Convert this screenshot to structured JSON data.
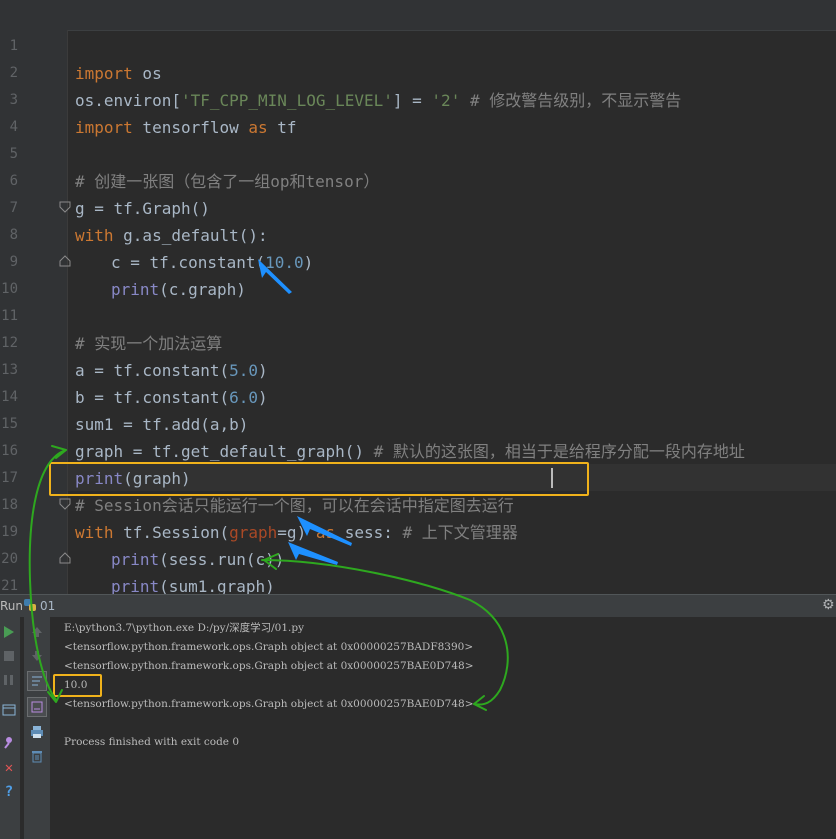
{
  "editor": {
    "line_numbers": [
      "1",
      "2",
      "3",
      "4",
      "5",
      "6",
      "7",
      "8",
      "9",
      "10",
      "11",
      "12",
      "13",
      "14",
      "15",
      "16",
      "17",
      "18",
      "19",
      "20",
      "21"
    ],
    "lines": {
      "l1": {
        "kw": "import",
        "rest": " os"
      },
      "l2": {
        "a": "os.environ[",
        "str1": "'TF_CPP_MIN_LOG_LEVEL'",
        "b": "] = ",
        "str2": "'2'",
        "cmt": " # 修改警告级别，不显示警告"
      },
      "l3": {
        "kw1": "import",
        "mid": " tensorflow ",
        "kw2": "as",
        "rest": " tf"
      },
      "l5": {
        "cmt": "# 创建一张图（包含了一组op和tensor）"
      },
      "l6": {
        "text": "g = tf.Graph()"
      },
      "l7": {
        "kw": "with",
        "rest": " g.as_default():"
      },
      "l8": {
        "a": "c = tf.constant(",
        "num": "10.0",
        "b": ")"
      },
      "l9": {
        "bi": "print",
        "rest": "(c.graph)"
      },
      "l11": {
        "cmt": "# 实现一个加法运算"
      },
      "l12": {
        "a": "a = tf.constant(",
        "num": "5.0",
        "b": ")"
      },
      "l13": {
        "a": "b = tf.constant(",
        "num": "6.0",
        "b": ")"
      },
      "l14": {
        "text": "sum1 = tf.add(a,b)"
      },
      "l15": {
        "text": "graph = tf.get_default_graph()",
        "cmt": " # 默认的这张图，相当于是给程序分配一段内存地址"
      },
      "l16": {
        "bi": "print",
        "rest": "(graph)"
      },
      "l17": {
        "cmt": "# Session会话只能运行一个图，可以在会话中指定图去运行"
      },
      "l18": {
        "kw": "with",
        "a": " tf.Session(",
        "prm": "graph",
        "b": "=g) ",
        "kw2": "as",
        "c": " sess:",
        "cmt": " # 上下文管理器"
      },
      "l19": {
        "bi": "print",
        "rest": "(sess.run(c))"
      },
      "l20": {
        "bi": "print",
        "rest": "(sum1.graph)"
      }
    }
  },
  "run": {
    "title": "Run",
    "config_name": "01"
  },
  "console": {
    "lines": [
      "E:\\python3.7\\python.exe D:/py/深度学习/01.py",
      "<tensorflow.python.framework.ops.Graph object at 0x00000257BADF8390>",
      "<tensorflow.python.framework.ops.Graph object at 0x00000257BAE0D748>",
      "10.0",
      "<tensorflow.python.framework.ops.Graph object at 0x00000257BAE0D748>",
      "",
      "Process finished with exit code 0"
    ]
  },
  "colors": {
    "background": "#2b2b2b",
    "keyword": "#cc7832",
    "string": "#6a8759",
    "number": "#6897bb",
    "comment": "#808080",
    "builtin": "#8888c6",
    "highlight_box": "#f0b21b",
    "annotation_blue": "#1e90ff",
    "annotation_green": "#2ea81f"
  },
  "icons": {
    "run": "run-icon",
    "stop": "stop-icon",
    "pause": "pause-icon",
    "up": "arrow-up-icon",
    "down": "arrow-down-icon",
    "settings": "gear-icon",
    "close": "close-icon",
    "help": "help-icon",
    "print": "print-icon",
    "trash": "trash-icon"
  }
}
